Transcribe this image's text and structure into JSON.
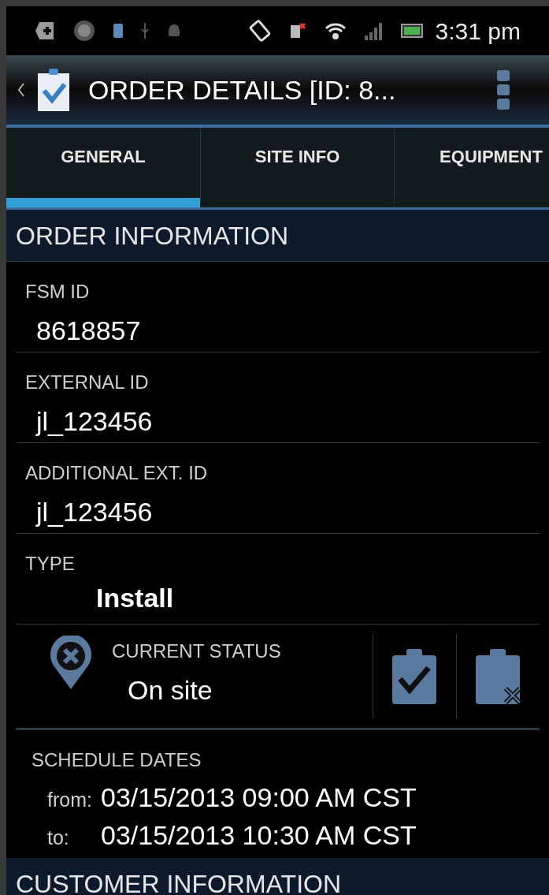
{
  "status_bar": {
    "time": "3:31 pm"
  },
  "action_bar": {
    "title": "ORDER DETAILS [ID: 8..."
  },
  "tabs": [
    {
      "label": "GENERAL",
      "selected": true
    },
    {
      "label": "SITE INFO",
      "selected": false
    },
    {
      "label": "EQUIPMENT",
      "selected": false
    }
  ],
  "sections": [
    {
      "title": "ORDER INFORMATION"
    },
    {
      "title": "CUSTOMER INFORMATION"
    }
  ],
  "fields": [
    {
      "label": "FSM ID",
      "value": "8618857",
      "kind": "plain"
    },
    {
      "label": "EXTERNAL ID",
      "value": "jl_123456",
      "kind": "plain"
    },
    {
      "label": "ADDITIONAL EXT. ID",
      "value": "jl_123456",
      "kind": "plain"
    },
    {
      "label": "TYPE",
      "value": "Install",
      "kind": "bold"
    }
  ],
  "current_status": {
    "label": "CURRENT STATUS",
    "value": "On site"
  },
  "schedule": {
    "label": "SCHEDULE DATES",
    "rows": [
      {
        "prefix": "from:",
        "value": "03/15/2013 09:00 AM CST"
      },
      {
        "prefix": "to:",
        "value": "03/15/2013 10:30 AM CST"
      }
    ]
  }
}
